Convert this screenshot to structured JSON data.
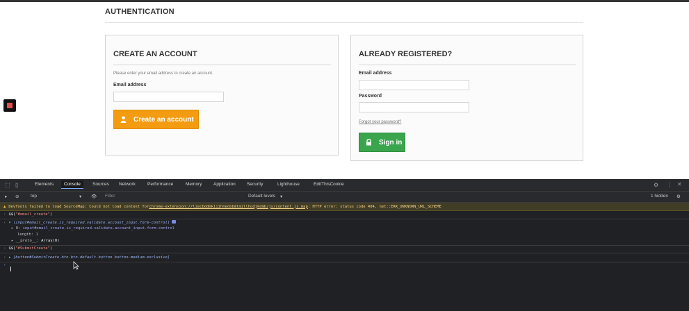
{
  "page": {
    "section_title": "AUTHENTICATION"
  },
  "create": {
    "heading": "CREATE AN ACCOUNT",
    "hint": "Please enter your email address to create an account.",
    "email_label": "Email address",
    "email_value": "",
    "button_label": "Create an account",
    "button_icon": "user-icon",
    "button_color": "#f39c11"
  },
  "login": {
    "heading": "ALREADY REGISTERED?",
    "email_label": "Email address",
    "email_value": "",
    "password_label": "Password",
    "password_value": "",
    "forgot_link": "Forgot your password?",
    "button_label": "Sign in",
    "button_icon": "lock-icon",
    "button_color": "#3aa54d"
  },
  "devtools": {
    "tabs": [
      "Elements",
      "Console",
      "Sources",
      "Network",
      "Performance",
      "Memory",
      "Application",
      "Security",
      "Lighthouse",
      "EditThisCookie"
    ],
    "active_tab": "Console",
    "context": "top",
    "filter_placeholder": "Filter",
    "levels": "Default levels",
    "hidden_count": "1 hidden",
    "warning": {
      "prefix": "DevTools failed to load SourceMap: Could not load content for ",
      "link": "chrome-extension://liecbddmkiiihnedobmlmillhodjkdmb/js/content.js.map",
      "suffix": ": HTTP error: status code 404, net::ERR_UNKNOWN_URL_SCHEME"
    },
    "console": {
      "cmd1_fn": "$$(",
      "cmd1_arg": "\"#email_create\"",
      "cmd1_close": ")",
      "result1": "(input#email_create.is_required.validate.account_input.form-control]",
      "result1_index": "0:",
      "result1_item": "input#email_create.is_required.validate.account_input.form-control",
      "length_key": "length:",
      "length_value": "1",
      "proto_key": "__proto__:",
      "proto_value": "Array(0)",
      "cmd2_fn": "$$(",
      "cmd2_arg": "\"#SubmitCreate\"",
      "cmd2_close": ")",
      "result2": "[button#SubmitCreate.btn.btn-default.button.button-medium.exclusive]"
    }
  }
}
